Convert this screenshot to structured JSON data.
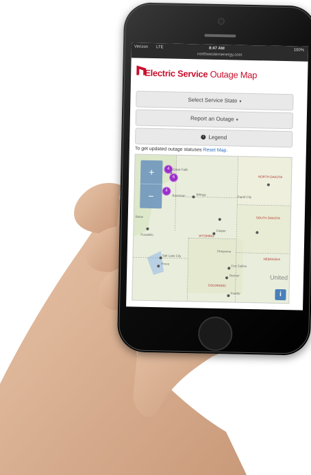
{
  "status_bar": {
    "carrier": "Verizon",
    "network": "LTE",
    "time": "8:47 AM",
    "battery": "100%",
    "url": "northwesternenergy.com"
  },
  "header": {
    "title_bold": "Electric Service",
    "title_regular": "Outage Map",
    "brand_color": "#c8102e"
  },
  "buttons": {
    "select_state": "Select Service State",
    "report_outage": "Report an Outage",
    "legend": "Legend"
  },
  "note": {
    "text": "To get updated outage statuses",
    "link": "Reset Map."
  },
  "map": {
    "zoom_in": "+",
    "zoom_out": "−",
    "markers": [
      "4",
      "6",
      "4"
    ],
    "info_label": "i",
    "place_labels": [
      "Great Falls",
      "Billings",
      "NORTH DAKOTA",
      "SOUTH DAKOTA",
      "WYOMING",
      "NEBRASKA",
      "Casper",
      "Salt Lake City",
      "Provo",
      "Fort Collins",
      "Denver",
      "COLORADO",
      "Pueblo",
      "Pocatello",
      "Boise",
      "Cheyenne",
      "Bozeman",
      "Rapid City",
      "United"
    ]
  }
}
